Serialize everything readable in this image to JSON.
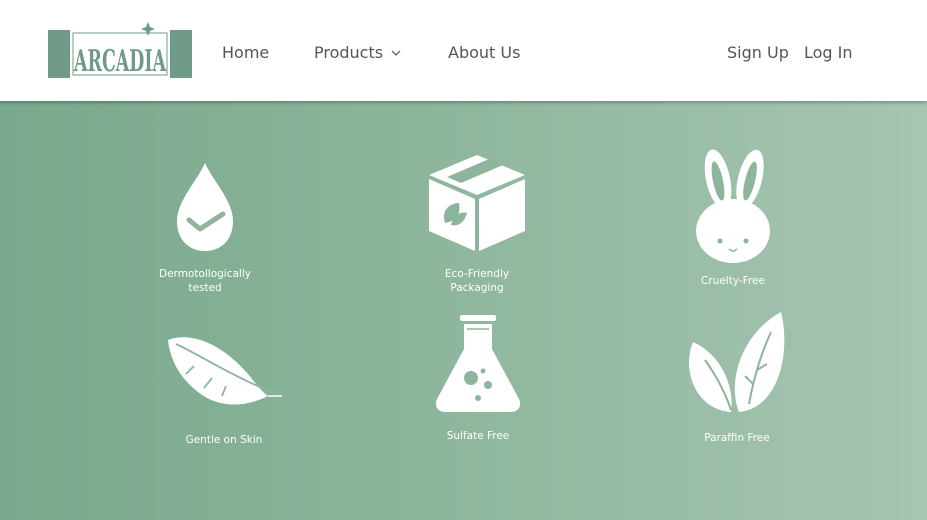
{
  "brand": {
    "logo_text": "ARCADIA",
    "logo_color": "#6f9a85"
  },
  "nav": {
    "home": "Home",
    "products": "Products",
    "about": "About Us",
    "signup": "Sign Up",
    "login": "Log In"
  },
  "features": [
    {
      "label": "Dermotollogically\ntested",
      "icon": "drop-check-icon"
    },
    {
      "label": "Eco-Friendly\nPackaging",
      "icon": "eco-box-icon"
    },
    {
      "label": "Cruelty-Free",
      "icon": "bunny-icon"
    },
    {
      "label": "Gentle on Skin",
      "icon": "feather-icon"
    },
    {
      "label": "Sulfate Free",
      "icon": "flask-icon"
    },
    {
      "label": "Paraffin Free",
      "icon": "leaves-icon"
    }
  ],
  "colors": {
    "hero_start": "#78a88d",
    "hero_end": "#a6c5b2",
    "icon": "#ffffff"
  }
}
